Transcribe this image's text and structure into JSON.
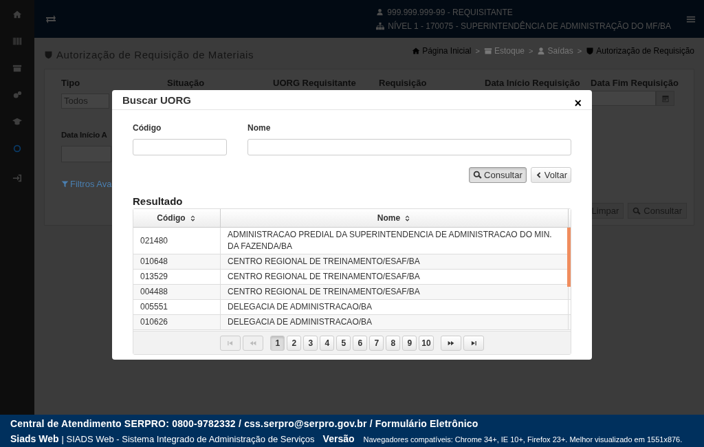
{
  "header": {
    "user": "999.999.999-99 - REQUISITANTE",
    "unit": "NÍVEL 1 - 170075 - SUPERINTENDÊNCIA DE ADMINISTRAÇÃO DO MF/BA"
  },
  "page": {
    "title": "Autorização de Requisição de Materiais",
    "separator": ">",
    "breadcrumb": [
      {
        "label": "Página Inicial",
        "kind": "home",
        "disabled": false
      },
      {
        "label": "Estoque",
        "kind": "box",
        "disabled": true
      },
      {
        "label": "Saídas",
        "kind": "user",
        "disabled": true
      },
      {
        "label": "Autorização de Requisição",
        "kind": "shield",
        "disabled": false
      }
    ]
  },
  "filters": {
    "fields": [
      {
        "label": "Tipo",
        "kind": "select",
        "value": "Todos"
      },
      {
        "label": "Situação",
        "kind": "label"
      },
      {
        "label": "UORG Requisitante",
        "kind": "label"
      },
      {
        "label": "Requisição",
        "kind": "label"
      },
      {
        "label": "Data Início Requisição",
        "kind": "label"
      },
      {
        "label": "Data Fim Requisição",
        "kind": "date"
      }
    ],
    "second_row": [
      {
        "label": "Data Início A",
        "kind": "text"
      }
    ],
    "advanced_link": "Filtros Ava",
    "buttons": [
      {
        "label": "Limpar",
        "kind": "clear"
      },
      {
        "label": "Consultar",
        "kind": "search"
      }
    ]
  },
  "modal": {
    "title": "Buscar UORG",
    "close": "×",
    "fields": [
      {
        "label": "Código",
        "kind": "short"
      },
      {
        "label": "Nome",
        "kind": "long"
      }
    ],
    "buttons": [
      {
        "label": "Consultar",
        "kind": "search",
        "pressed": true
      },
      {
        "label": "Voltar",
        "kind": "back",
        "pressed": false
      }
    ],
    "result_title": "Resultado",
    "table": {
      "columns": [
        "Código",
        "Nome"
      ],
      "rows": [
        [
          "021480",
          "ADMINISTRACAO PREDIAL DA SUPERINTENDENCIA DE ADMINISTRACAO DO MIN. DA FAZENDA/BA"
        ],
        [
          "010648",
          "CENTRO REGIONAL DE TREINAMENTO/ESAF/BA"
        ],
        [
          "013529",
          "CENTRO REGIONAL DE TREINAMENTO/ESAF/BA"
        ],
        [
          "004488",
          "CENTRO REGIONAL DE TREINAMENTO/ESAF/BA"
        ],
        [
          "005551",
          "DELEGACIA DE ADMINISTRACAO/BA"
        ],
        [
          "010626",
          "DELEGACIA DE ADMINISTRACAO/BA"
        ]
      ]
    },
    "pagination": {
      "nav_start": [
        {
          "kind": "first",
          "disabled": true
        },
        {
          "kind": "prev",
          "disabled": true
        }
      ],
      "pages": [
        {
          "label": "1",
          "selected": true
        },
        {
          "label": "2",
          "selected": false
        },
        {
          "label": "3",
          "selected": false
        },
        {
          "label": "4",
          "selected": false
        },
        {
          "label": "5",
          "selected": false
        },
        {
          "label": "6",
          "selected": false
        },
        {
          "label": "7",
          "selected": false
        },
        {
          "label": "8",
          "selected": false
        },
        {
          "label": "9",
          "selected": false
        },
        {
          "label": "10",
          "selected": false
        }
      ],
      "nav_end": [
        {
          "kind": "next",
          "disabled": false
        },
        {
          "kind": "last",
          "disabled": false
        }
      ]
    }
  },
  "footer": {
    "contact": "Central de Atendimento SERPRO: 0800-9782332 / css.serpro@serpro.gov.br / Formulário Eletrônico",
    "app": "Siads Web",
    "system": "| SIADS Web - Sistema Integrado de Administração de Serviços",
    "version": "Versão",
    "browsers": "Navegadores compatíveis: Chrome 34+, IE 10+, Firefox 23+. Melhor visualizado em 1551x876."
  }
}
